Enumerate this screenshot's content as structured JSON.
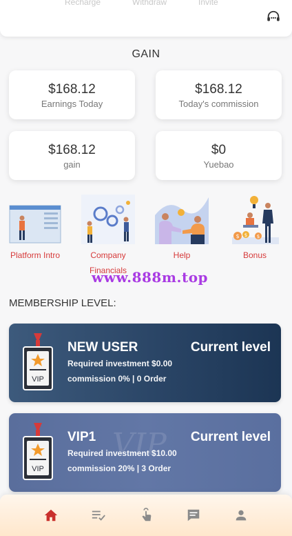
{
  "top": {
    "links": [
      "Recharge",
      "Withdraw",
      "Invite"
    ],
    "support_icon": "headset-icon"
  },
  "gain": {
    "title": "GAIN",
    "cards": [
      {
        "value": "$168.12",
        "label": "Earnings Today"
      },
      {
        "value": "$168.12",
        "label": "Today's commission"
      },
      {
        "value": "$168.12",
        "label": "gain"
      },
      {
        "value": "$0",
        "label": "Yuebao"
      }
    ]
  },
  "features": [
    {
      "label": "Platform Intro",
      "icon": "platform-intro-illustration"
    },
    {
      "label": "Company Financials",
      "icon": "company-financials-illustration"
    },
    {
      "label": "Help",
      "icon": "help-illustration"
    },
    {
      "label": "Bonus",
      "icon": "bonus-illustration"
    }
  ],
  "watermark": "www.888m.top",
  "membership": {
    "title": "MEMBERSHIP LEVEL:",
    "levels": [
      {
        "name": "NEW USER",
        "status": "Current level",
        "investment": "Required investment $0.00",
        "commission": "commission 0% | 0 Order"
      },
      {
        "name": "VIP1",
        "status": "Current level",
        "investment": "Required investment $10.00",
        "commission": "commission 20% | 3 Order"
      }
    ]
  },
  "bottom_nav": [
    "home-icon",
    "order-list-icon",
    "grab-order-icon",
    "message-icon",
    "profile-icon"
  ],
  "colors": {
    "accent": "#d63a3a",
    "watermark": "#a93be3",
    "level_dark": "#2a4566",
    "level_light": "#6277a6"
  }
}
